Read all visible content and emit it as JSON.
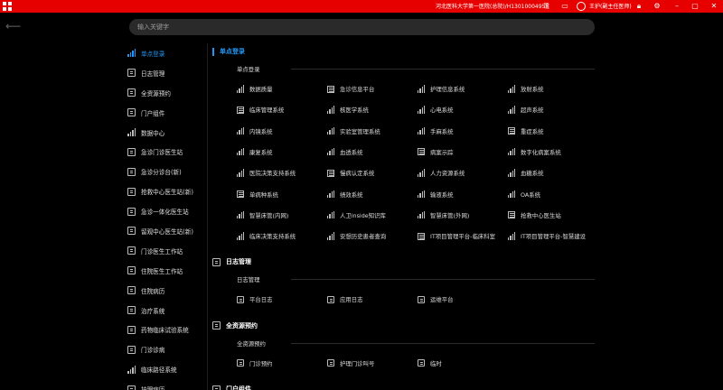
{
  "titlebar": {
    "hospital_phone": "河北医科大学第一医院(总院)/H13010004958",
    "user": "王护(副主任医师)"
  },
  "search": {
    "placeholder": "输入关键字"
  },
  "sidebar": {
    "items": [
      {
        "label": "单点登录",
        "icon": "bar-chart-icon",
        "active": true
      },
      {
        "label": "日志管理",
        "icon": "document-icon"
      },
      {
        "label": "全资源预约",
        "icon": "document-icon"
      },
      {
        "label": "门户组件",
        "icon": "document-icon"
      },
      {
        "label": "数据中心",
        "icon": "bar-chart-icon"
      },
      {
        "label": "急诊门诊医生站",
        "icon": "document-icon"
      },
      {
        "label": "急诊分诊台(新)",
        "icon": "document-icon"
      },
      {
        "label": "抢救中心医生站(新)",
        "icon": "document-icon"
      },
      {
        "label": "急诊一体化医生站",
        "icon": "document-icon"
      },
      {
        "label": "留观中心医生站(新)",
        "icon": "document-icon"
      },
      {
        "label": "门诊医生工作站",
        "icon": "document-icon"
      },
      {
        "label": "住院医生工作站",
        "icon": "document-icon"
      },
      {
        "label": "住院病历",
        "icon": "document-icon"
      },
      {
        "label": "治疗系统",
        "icon": "document-icon"
      },
      {
        "label": "药物临床试验系统",
        "icon": "document-icon"
      },
      {
        "label": "门诊诊病",
        "icon": "document-icon"
      },
      {
        "label": "临床路径系统",
        "icon": "bar-chart-icon"
      },
      {
        "label": "护理病历",
        "icon": "document-icon"
      }
    ]
  },
  "main": {
    "sections": [
      {
        "title": "单点登录",
        "subtitle": "单点登录",
        "items": [
          [
            "数据质量",
            "急诊信息平台",
            "护理信息系统",
            "放射系统"
          ],
          [
            "临床管理系统",
            "核医学系统",
            "心电系统",
            "超声系统"
          ],
          [
            "内镜系统",
            "实验室管理系统",
            "手麻系统",
            "重症系统"
          ],
          [
            "康复系统",
            "血透系统",
            "病案示踪",
            "数字化病案系统"
          ],
          [
            "医院决策支持系统",
            "慢病认定系统",
            "人力资源系统",
            "血糖系统"
          ],
          [
            "单病种系统",
            "绩效系统",
            "输液系统",
            "OA系统"
          ],
          [
            "智慧床管(内网)",
            "人卫inside知识库",
            "智慧床管(外网)",
            "抢救中心医生站"
          ],
          [
            "临床决策支持系统",
            "安想历史患者查询",
            "IT项目管理平台-临床科室",
            "IT项目管理平台-智慧建设"
          ]
        ]
      },
      {
        "title": "日志管理",
        "subtitle": "日志管理",
        "items": [
          [
            "平台日志",
            "应用日志",
            "运维平台"
          ]
        ]
      },
      {
        "title": "全资源预约",
        "subtitle": "全资源预约",
        "items": [
          [
            "门诊预约",
            "护理门诊叫号",
            "临时"
          ]
        ]
      },
      {
        "title": "门户组件"
      }
    ]
  },
  "colors": {
    "titlebar": "#e60000",
    "accent": "#2196f3",
    "background": "#000000"
  }
}
